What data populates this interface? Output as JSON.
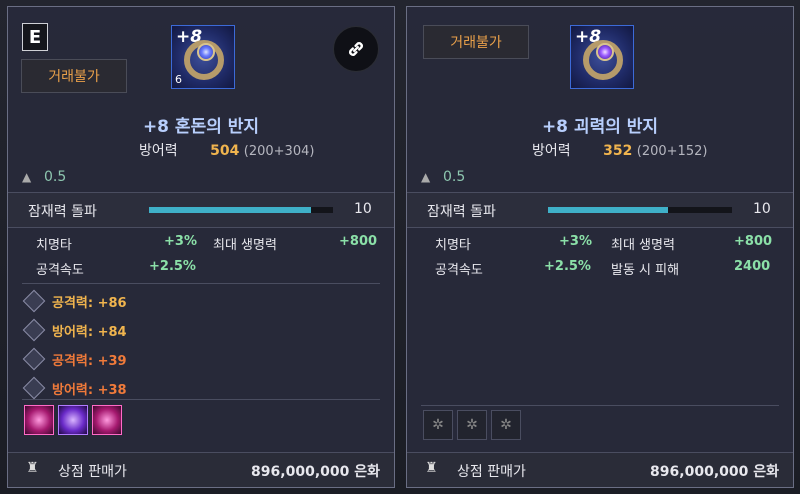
{
  "left": {
    "grade": "E",
    "trade_status": "거래불가",
    "item_level_badge": "+8",
    "lock_badge": "6",
    "title": "+8 혼돈의 반지",
    "defense": {
      "label": "방어력",
      "value": "504",
      "breakdown": "(200+304)"
    },
    "weight": "0.5",
    "potential": {
      "label": "잠재력 돌파",
      "value": "10",
      "fill_percent": 88
    },
    "stats": [
      {
        "name": "치명타",
        "value": "+3%"
      },
      {
        "name": "최대 생명력",
        "value": "+800"
      },
      {
        "name": "공격속도",
        "value": "+2.5%"
      }
    ],
    "engravings": [
      {
        "text": "공격력: +86",
        "color": "#f0b44e"
      },
      {
        "text": "방어력: +84",
        "color": "#f0b44e"
      },
      {
        "text": "공격력: +39",
        "color": "#f07a3a"
      },
      {
        "text": "방어력: +38",
        "color": "#f07a3a"
      }
    ],
    "sell_label": "상점 판매가",
    "sell_price": "896,000,000 은화"
  },
  "right": {
    "trade_status": "거래불가",
    "item_level_badge": "+8",
    "title": "+8 괴력의 반지",
    "defense": {
      "label": "방어력",
      "value": "352",
      "breakdown": "(200+152)"
    },
    "weight": "0.5",
    "potential": {
      "label": "잠재력 돌파",
      "value": "10",
      "fill_percent": 65
    },
    "stats": [
      {
        "name": "치명타",
        "value": "+3%"
      },
      {
        "name": "최대 생명력",
        "value": "+800"
      },
      {
        "name": "공격속도",
        "value": "+2.5%"
      },
      {
        "name": "발동 시 피해",
        "value": "2400"
      }
    ],
    "sell_label": "상점 판매가",
    "sell_price": "896,000,000 은화"
  },
  "colors": {
    "accent_title": "#b8cffd",
    "gold": "#f0b44e",
    "green": "#8be0a8",
    "bar": "#3fb0c8"
  }
}
